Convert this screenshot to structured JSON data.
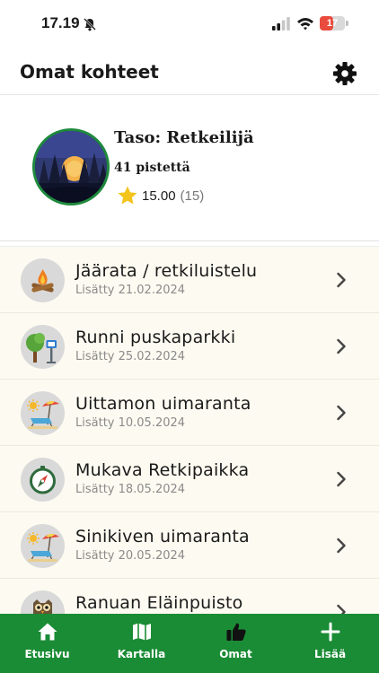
{
  "status_bar": {
    "time": "17.19",
    "battery_level": 17,
    "battery_text": "17",
    "icons": [
      "bell-off-icon",
      "signal-icon",
      "wifi-icon",
      "battery-icon"
    ]
  },
  "header": {
    "title": "Omat kohteet",
    "settings_icon": "gear-icon"
  },
  "profile": {
    "level": "Taso: Retkeilijä",
    "points": "41 pistettä",
    "rating_value": "15.00",
    "rating_count": "(15)",
    "avatar_icon": "forest-sunset-avatar"
  },
  "places": [
    {
      "title": "Jäärata / retkiluistelu",
      "date": "Lisätty 21.02.2024",
      "icon": "campfire-icon"
    },
    {
      "title": "Runni puskaparkki",
      "date": "Lisätty 25.02.2024",
      "icon": "tree-parking-icon"
    },
    {
      "title": "Uittamon uimaranta",
      "date": "Lisätty 10.05.2024",
      "icon": "beach-icon"
    },
    {
      "title": "Mukava Retkipaikka",
      "date": "Lisätty 18.05.2024",
      "icon": "compass-icon"
    },
    {
      "title": "Sinikiven uimaranta",
      "date": "Lisätty 20.05.2024",
      "icon": "beach-icon"
    },
    {
      "title": "Ranuan Eläinpuisto",
      "date": "",
      "icon": "owl-icon"
    }
  ],
  "tabbar": {
    "tabs": [
      {
        "label": "Etusivu",
        "icon": "home-icon"
      },
      {
        "label": "Kartalla",
        "icon": "map-icon"
      },
      {
        "label": "Omat",
        "icon": "thumbs-up-icon",
        "active": true
      },
      {
        "label": "Lisää",
        "icon": "plus-icon"
      }
    ]
  },
  "colors": {
    "accent": "#1a8c35",
    "list_background": "#fdfbf1",
    "star": "#f2c41c",
    "battery_low": "#e94b3c"
  }
}
